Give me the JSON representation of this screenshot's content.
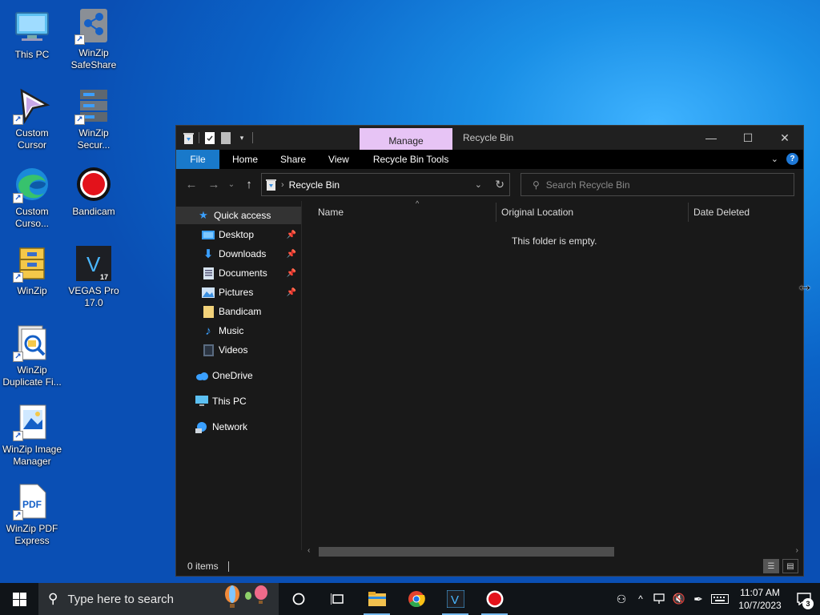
{
  "desktop": {
    "icons": [
      {
        "label": "This PC",
        "icon": "this-pc-icon"
      },
      {
        "label": "WinZip SafeShare",
        "icon": "winzip-safeshare-icon"
      },
      {
        "label": "Custom Cursor",
        "icon": "custom-cursor-icon"
      },
      {
        "label": "WinZip Secur...",
        "icon": "winzip-secure-icon"
      },
      {
        "label": "Custom Curso...",
        "icon": "edge-icon"
      },
      {
        "label": "Bandicam",
        "icon": "bandicam-icon"
      },
      {
        "label": "WinZip",
        "icon": "winzip-icon"
      },
      {
        "label": "VEGAS Pro 17.0",
        "icon": "vegas-pro-icon"
      },
      {
        "label": "WinZip Duplicate Fi...",
        "icon": "winzip-duplicate-icon"
      },
      {
        "label": "WinZip Image Manager",
        "icon": "winzip-image-icon"
      },
      {
        "label": "WinZip PDF Express",
        "icon": "winzip-pdf-icon"
      }
    ]
  },
  "window": {
    "title": "Recycle Bin",
    "contextual_tab": "Manage",
    "ribbon_tabs": [
      "File",
      "Home",
      "Share",
      "View",
      "Recycle Bin Tools"
    ],
    "address_path": "Recycle Bin",
    "search_placeholder": "Search Recycle Bin",
    "nav": {
      "quick_access": "Quick access",
      "items": [
        {
          "label": "Desktop",
          "pinned": true
        },
        {
          "label": "Downloads",
          "pinned": true
        },
        {
          "label": "Documents",
          "pinned": true
        },
        {
          "label": "Pictures",
          "pinned": true
        },
        {
          "label": "Bandicam",
          "pinned": false
        },
        {
          "label": "Music",
          "pinned": false
        },
        {
          "label": "Videos",
          "pinned": false
        }
      ],
      "onedrive": "OneDrive",
      "this_pc": "This PC",
      "network": "Network"
    },
    "columns": [
      "Name",
      "Original Location",
      "Date Deleted"
    ],
    "empty_message": "This folder is empty.",
    "status_count": "0 items"
  },
  "taskbar": {
    "search_label": "Type here to search",
    "time": "11:07 AM",
    "date": "10/7/2023",
    "notification_count": "3"
  }
}
